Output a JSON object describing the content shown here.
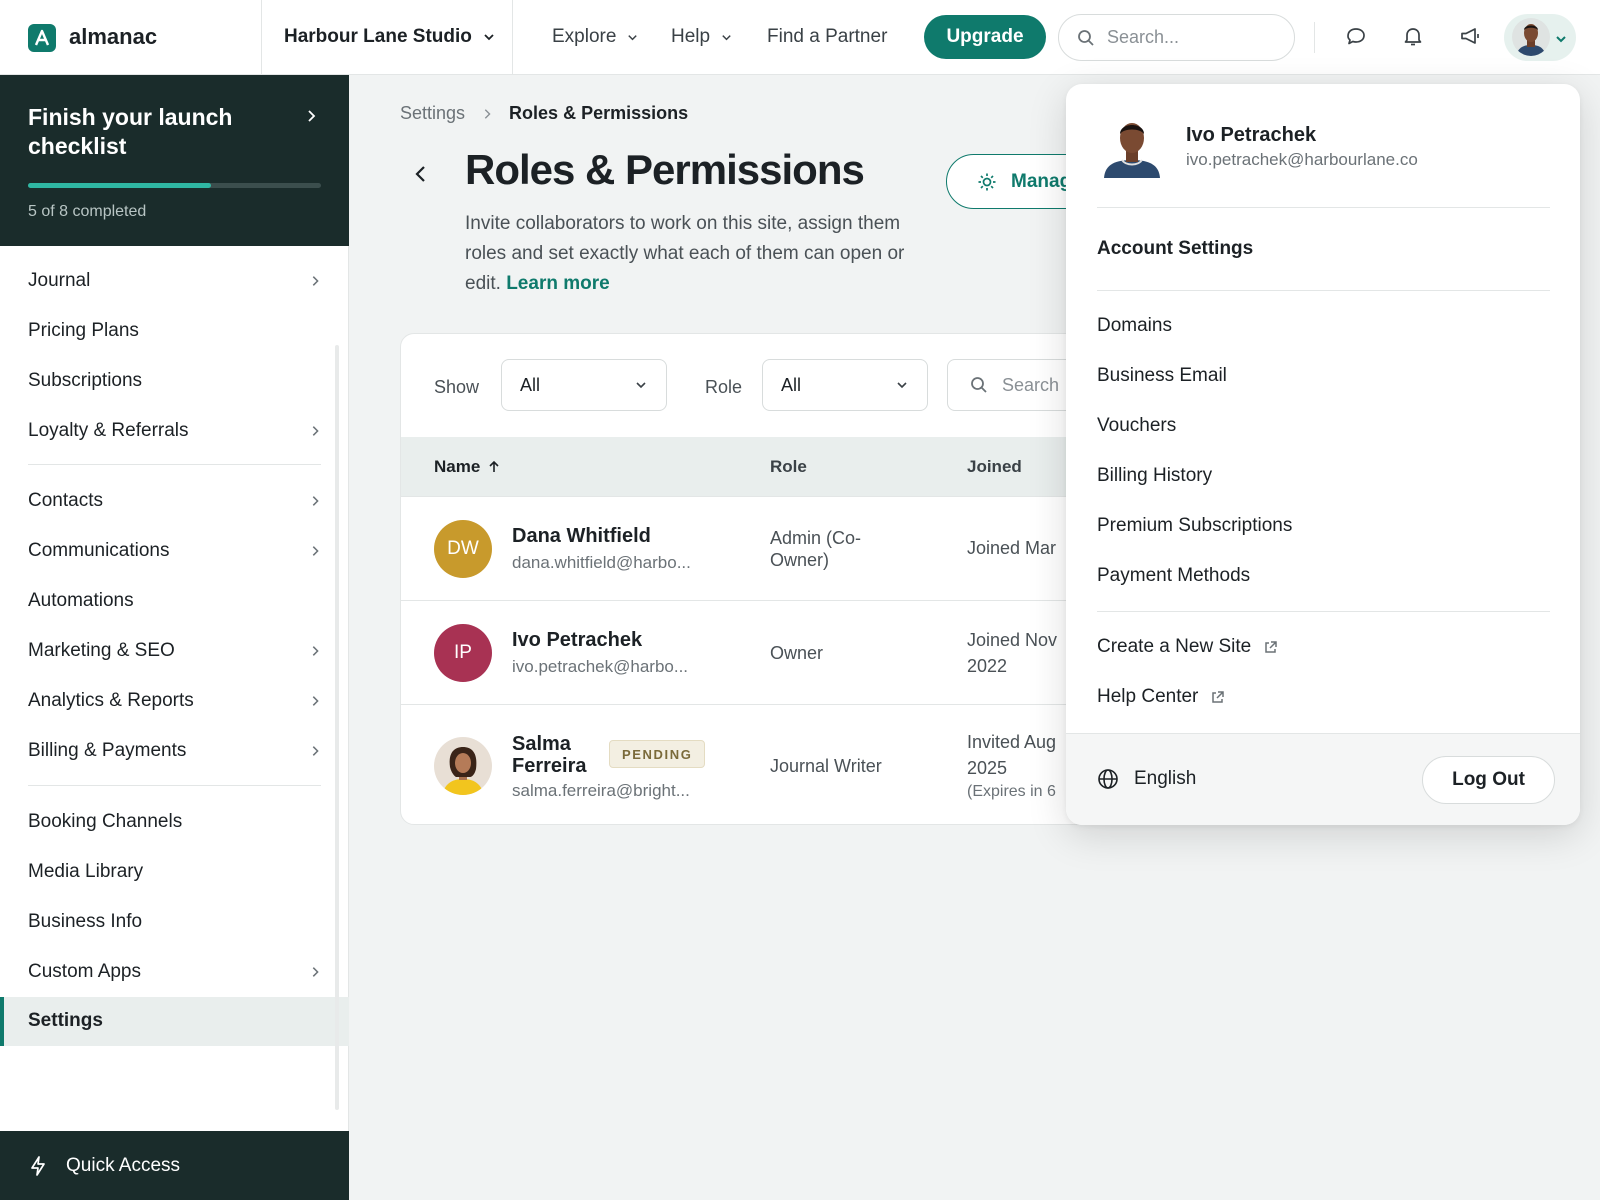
{
  "topbar": {
    "brand": "almanac",
    "site_name": "Harbour Lane Studio",
    "nav": [
      {
        "label": "Explore",
        "has_menu": true
      },
      {
        "label": "Help",
        "has_menu": true
      },
      {
        "label": "Find a Partner",
        "has_menu": false
      }
    ],
    "upgrade_label": "Upgrade",
    "search_placeholder": "Search...",
    "icons": [
      "chat-icon",
      "bell-icon",
      "megaphone-icon",
      "avatar",
      "chevron-down-icon"
    ],
    "accent_color": "#0f7a6c"
  },
  "sidebar": {
    "checklist": {
      "title": "Finish your launch checklist",
      "status": "5 of 8 completed",
      "completed": 5,
      "total": 8
    },
    "groups": [
      [
        {
          "label": "Journal",
          "has_submenu": true
        },
        {
          "label": "Pricing Plans",
          "has_submenu": false
        },
        {
          "label": "Subscriptions",
          "has_submenu": false
        },
        {
          "label": "Loyalty & Referrals",
          "has_submenu": true
        }
      ],
      [
        {
          "label": "Contacts",
          "has_submenu": true
        },
        {
          "label": "Communications",
          "has_submenu": true
        },
        {
          "label": "Automations",
          "has_submenu": false
        },
        {
          "label": "Marketing & SEO",
          "has_submenu": true
        },
        {
          "label": "Analytics & Reports",
          "has_submenu": true
        },
        {
          "label": "Billing & Payments",
          "has_submenu": true
        }
      ],
      [
        {
          "label": "Booking Channels",
          "has_submenu": false
        },
        {
          "label": "Media Library",
          "has_submenu": false
        },
        {
          "label": "Business Info",
          "has_submenu": false
        },
        {
          "label": "Custom Apps",
          "has_submenu": true
        },
        {
          "label": "Settings",
          "has_submenu": false,
          "active": true
        }
      ]
    ],
    "quick_access": "Quick Access"
  },
  "main": {
    "breadcrumb": {
      "parent": "Settings",
      "current": "Roles & Permissions"
    },
    "title": "Roles & Permissions",
    "description": "Invite collaborators to work on this site, assign them roles and set exactly what each of them can open or edit.",
    "learn_more": "Learn more",
    "manage_button": "Manag",
    "filters": {
      "show_label": "Show",
      "show_value": "All",
      "role_label": "Role",
      "role_value": "All",
      "search_placeholder": "Search"
    },
    "table": {
      "columns": {
        "name": "Name",
        "role": "Role",
        "joined": "Joined"
      },
      "rows": [
        {
          "initials": "DW",
          "avatar_color": "#c89a2c",
          "name": "Dana Whitfield",
          "email": "dana.whitfield@harbo...",
          "role": "Admin (Co-Owner)",
          "joined": "Joined Mar",
          "joined_sub": ""
        },
        {
          "initials": "IP",
          "avatar_color": "#a83253",
          "name": "Ivo Petrachek",
          "email": "ivo.petrachek@harbo...",
          "role": "Owner",
          "joined": "Joined Nov 2022",
          "joined_sub": ""
        },
        {
          "initials": "",
          "avatar_color": "#d9cfc4",
          "name": "Salma Ferreira",
          "badge": "PENDING",
          "email": "salma.ferreira@bright...",
          "role": "Journal Writer",
          "joined": "Invited Aug 2025",
          "joined_sub": "(Expires in 6"
        }
      ]
    }
  },
  "account_menu": {
    "name": "Ivo Petrachek",
    "email": "ivo.petrachek@harbourlane.co",
    "heading": "Account Settings",
    "items": [
      "Domains",
      "Business Email",
      "Vouchers",
      "Billing History",
      "Premium Subscriptions",
      "Payment Methods"
    ],
    "external_items": [
      "Create a New Site",
      "Help Center"
    ],
    "language": "English",
    "logout": "Log Out"
  }
}
